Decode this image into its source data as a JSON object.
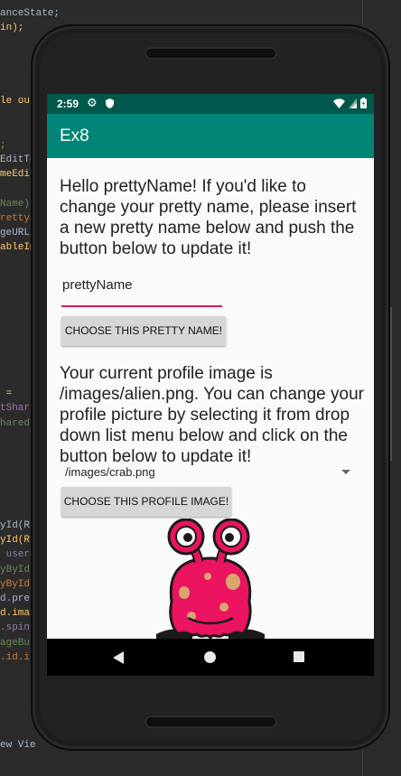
{
  "ide": {
    "code_lines": [
      "anceState;",
      "in);",
      "",
      "",
      "",
      "",
      "le ou",
      "",
      "",
      ";",
      "EditTe",
      "meEdit",
      "",
      "Name)",
      "rettyN",
      "geURL)",
      "ableIm",
      "",
      "",
      "",
      "",
      "",
      "",
      "",
      "",
      "",
      " =",
      "tShar",
      "hared",
      "",
      "",
      "",
      "",
      "",
      "",
      "yId(R.",
      "yId(R.",
      " userN",
      "yById(",
      "yById(",
      "d.pre",
      "d.ima",
      ".spin",
      "ageBut",
      ".id.i",
      "",
      "",
      "",
      "",
      "",
      "ew Vie"
    ]
  },
  "status_bar": {
    "time": "2:59",
    "gear_icon": "gear-icon",
    "shield_icon": "shield-icon",
    "wifi_icon": "wifi-icon",
    "signal_icon": "signal-icon",
    "battery_icon": "battery-icon"
  },
  "app_bar": {
    "title": "Ex8"
  },
  "main": {
    "greeting": "Hello prettyName! If you'd like to change your pretty name, please insert a new pretty name below and push the button below to update it!",
    "name_input_value": "prettyName",
    "choose_name_button": "CHOOSE THIS PRETTY NAME!",
    "profile_text": "Your current profile image is /images/alien.png. You can change your profile picture by selecting it from drop down list menu below and click on the button below to update it!",
    "image_spinner_value": "/images/crab.png",
    "choose_image_button": "CHOOSE THIS PROFILE IMAGE!",
    "profile_image_icon": "alien-image"
  },
  "nav_bar": {
    "back_icon": "back-icon",
    "home_icon": "home-icon",
    "recents_icon": "recents-icon"
  },
  "colors": {
    "primary": "#008577",
    "primary_dark": "#00574b",
    "accent": "#d81b60",
    "alien_body": "#ea1460",
    "alien_spots": "#d9a66d"
  }
}
